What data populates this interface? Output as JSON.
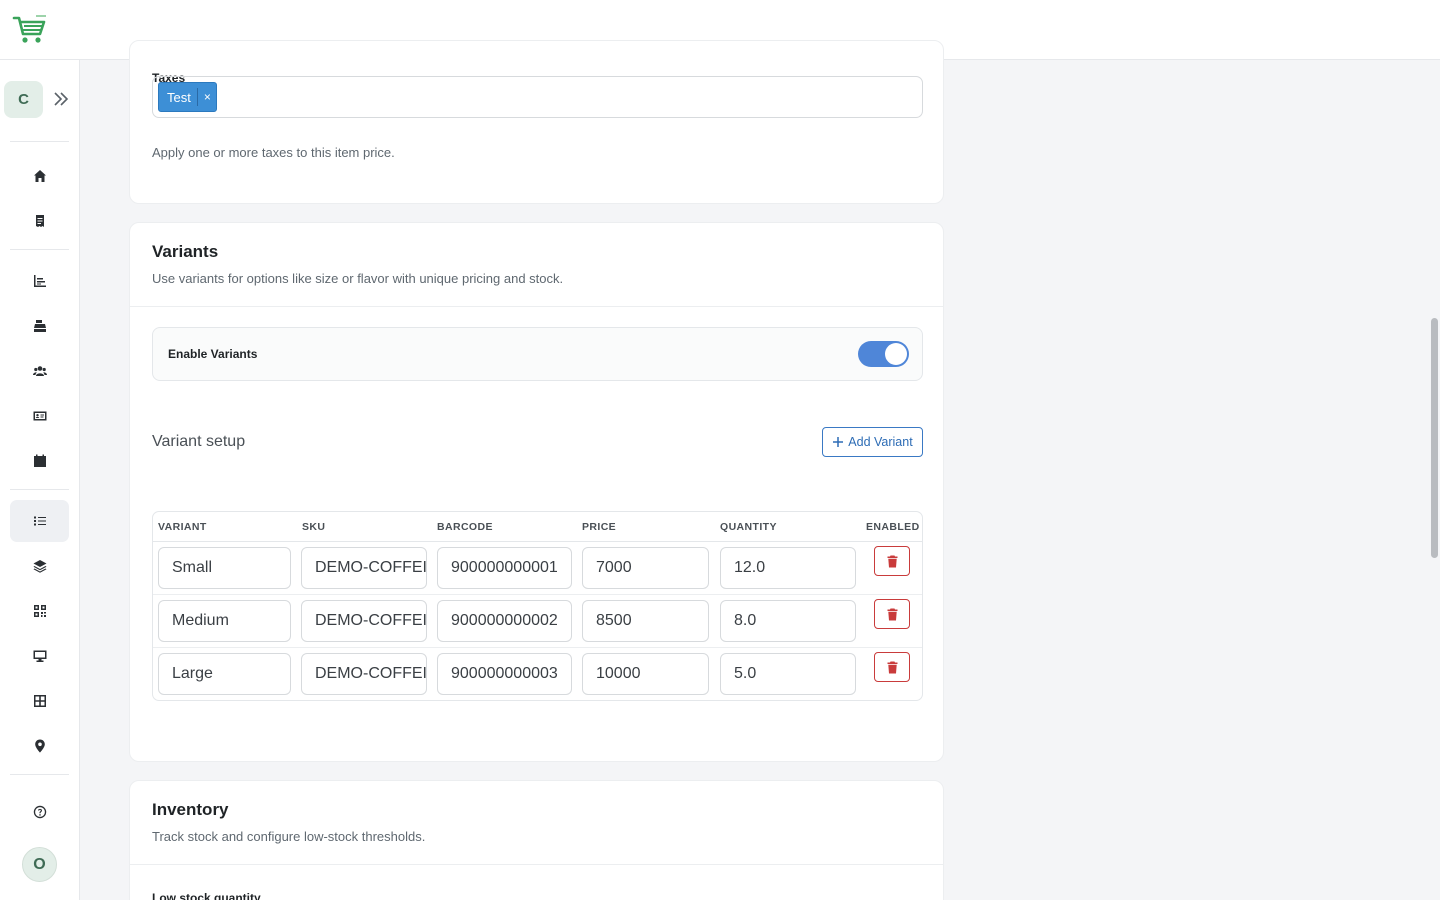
{
  "taxes": {
    "label": "Taxes",
    "tags": [
      {
        "label": "Test",
        "remove": "×"
      }
    ],
    "help": "Apply one or more taxes to this item price."
  },
  "sidebar": {
    "company_initial": "C",
    "user_initial": "O"
  },
  "variants": {
    "title": "Variants",
    "subtitle": "Use variants for options like size or flavor with unique pricing and stock.",
    "toggle_label": "Enable Variants",
    "toggle_on": true,
    "setup_heading": "Variant setup",
    "add_button": "Add Variant",
    "columns": [
      "VARIANT",
      "SKU",
      "BARCODE",
      "PRICE",
      "QUANTITY",
      "ENABLED"
    ],
    "rows": [
      {
        "variant": "Small",
        "sku": "DEMO-COFFEI",
        "barcode": "900000000001",
        "price": "7000",
        "quantity": "12.0"
      },
      {
        "variant": "Medium",
        "sku": "DEMO-COFFEI",
        "barcode": "900000000002",
        "price": "8500",
        "quantity": "8.0"
      },
      {
        "variant": "Large",
        "sku": "DEMO-COFFEI",
        "barcode": "900000000003",
        "price": "10000",
        "quantity": "5.0"
      }
    ]
  },
  "inventory": {
    "title": "Inventory",
    "subtitle": "Track stock and configure low-stock thresholds.",
    "low_stock_label": "Low stock quantity"
  },
  "colors": {
    "accent": "#4f86d8",
    "tag": "#3d8fd6",
    "danger": "#c93b3b",
    "brand_green": "#3aa35a"
  }
}
